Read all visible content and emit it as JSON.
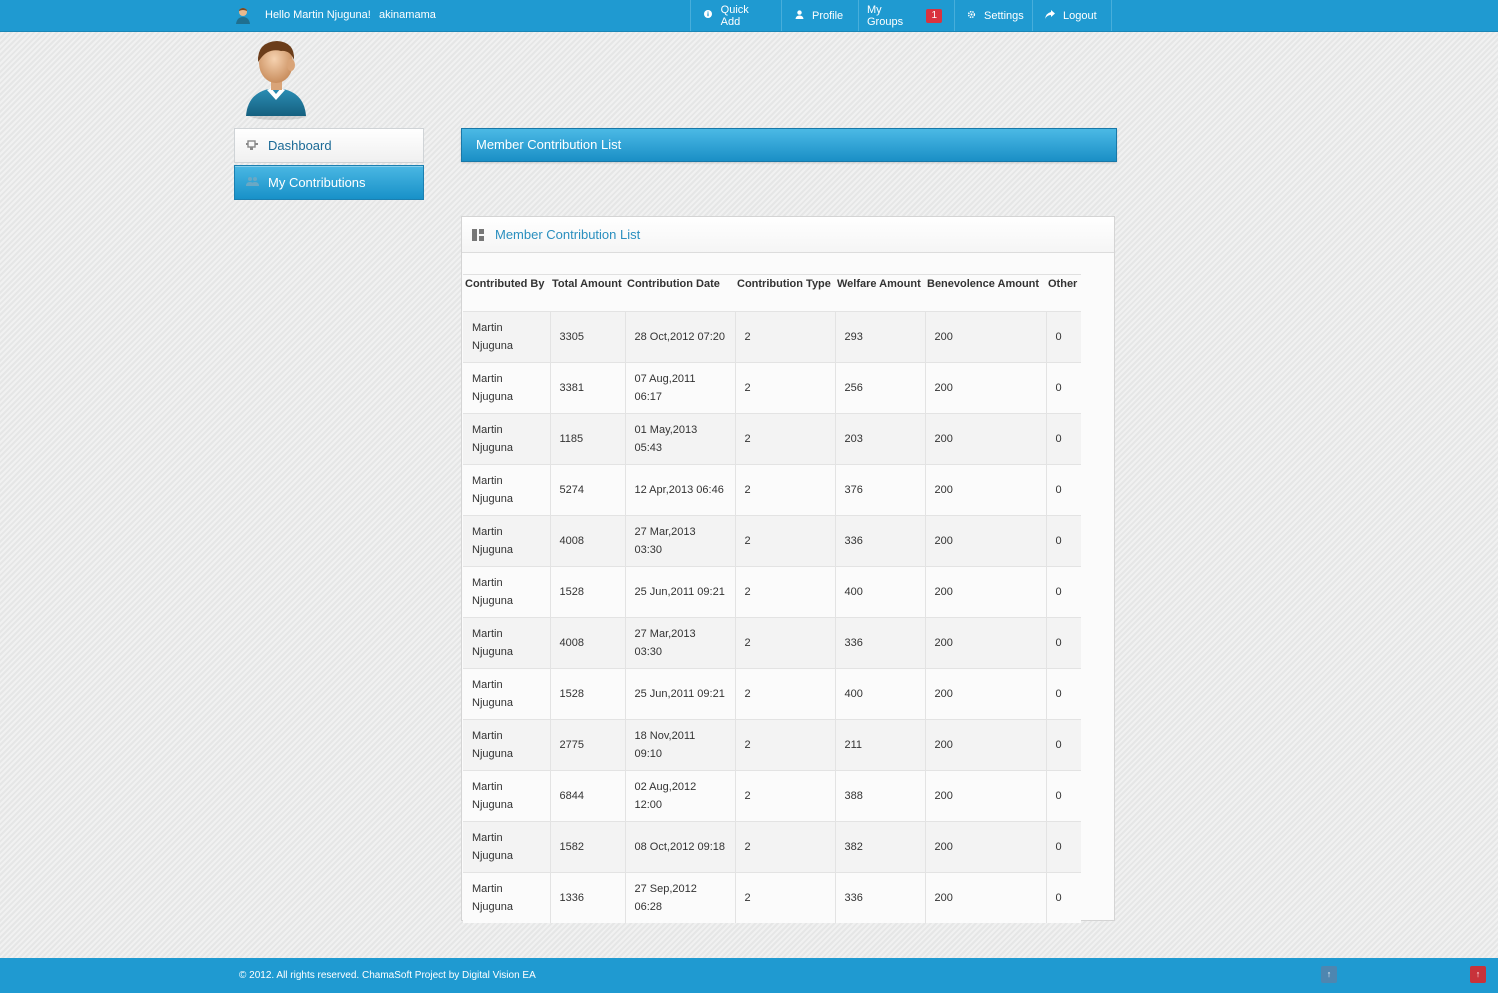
{
  "topbar": {
    "greeting": "Hello Martin Njuguna!",
    "username": "akinamama",
    "nav": {
      "quick_add": "Quick Add",
      "profile": "Profile",
      "my_groups": "My Groups",
      "my_groups_badge": "1",
      "settings": "Settings",
      "logout": "Logout"
    },
    "icons": {
      "quick_add": "info-circle-icon",
      "profile": "user-icon",
      "settings": "gear-icon",
      "logout": "share-arrow-icon"
    }
  },
  "sidebar": {
    "items": [
      {
        "label": "Dashboard",
        "icon": "dashboard-icon",
        "active": false
      },
      {
        "label": "My Contributions",
        "icon": "users-icon",
        "active": true
      }
    ]
  },
  "page_header": {
    "title": "Member Contribution List"
  },
  "box": {
    "title": "Member Contribution List",
    "table": {
      "headers": [
        "Contributed By",
        "Total Amount",
        "Contribution Date",
        "Contribution Type",
        "Welfare Amount",
        "Benevolence Amount",
        "Other"
      ],
      "rows": [
        [
          "Martin Njuguna",
          "3305",
          "28 Oct,2012 07:20",
          "2",
          "293",
          "200",
          "0"
        ],
        [
          "Martin Njuguna",
          "3381",
          "07 Aug,2011 06:17",
          "2",
          "256",
          "200",
          "0"
        ],
        [
          "Martin Njuguna",
          "1185",
          "01 May,2013 05:43",
          "2",
          "203",
          "200",
          "0"
        ],
        [
          "Martin Njuguna",
          "5274",
          "12 Apr,2013 06:46",
          "2",
          "376",
          "200",
          "0"
        ],
        [
          "Martin Njuguna",
          "4008",
          "27 Mar,2013 03:30",
          "2",
          "336",
          "200",
          "0"
        ],
        [
          "Martin Njuguna",
          "1528",
          "25 Jun,2011 09:21",
          "2",
          "400",
          "200",
          "0"
        ],
        [
          "Martin Njuguna",
          "4008",
          "27 Mar,2013 03:30",
          "2",
          "336",
          "200",
          "0"
        ],
        [
          "Martin Njuguna",
          "1528",
          "25 Jun,2011 09:21",
          "2",
          "400",
          "200",
          "0"
        ],
        [
          "Martin Njuguna",
          "2775",
          "18 Nov,2011 09:10",
          "2",
          "211",
          "200",
          "0"
        ],
        [
          "Martin Njuguna",
          "6844",
          "02 Aug,2012 12:00",
          "2",
          "388",
          "200",
          "0"
        ],
        [
          "Martin Njuguna",
          "1582",
          "08 Oct,2012 09:18",
          "2",
          "382",
          "200",
          "0"
        ],
        [
          "Martin Njuguna",
          "1336",
          "27 Sep,2012 06:28",
          "2",
          "336",
          "200",
          "0"
        ]
      ]
    }
  },
  "footer": {
    "copyright": "© 2012. All rights reserved. ChamaSoft Project by Digital Vision EA",
    "scroll_up_symbol": "↑"
  },
  "colors": {
    "topbar": "#1f9ad1",
    "accent": "#2a8fbf",
    "badge": "#d9333f"
  }
}
